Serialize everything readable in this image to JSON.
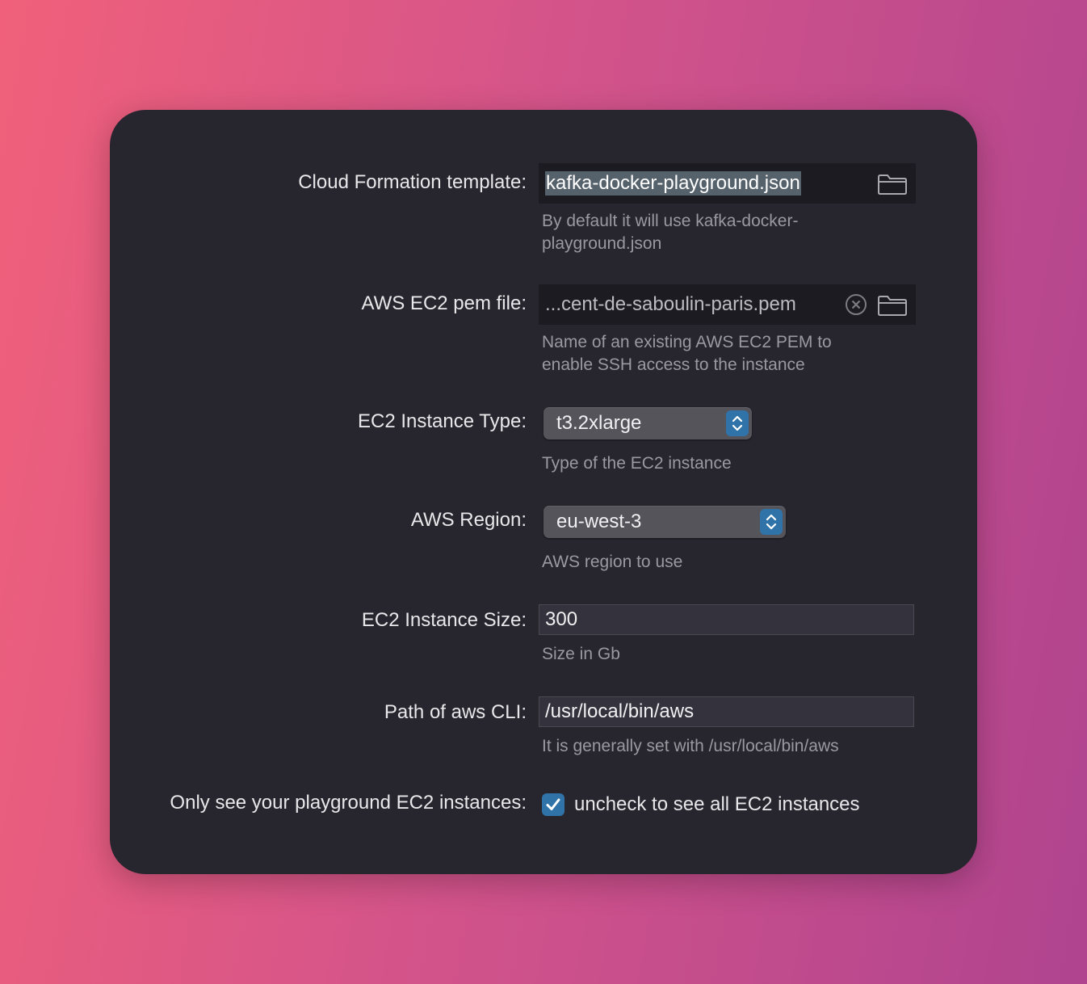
{
  "form": {
    "template": {
      "label": "Cloud Formation template:",
      "value": "kafka-docker-playground.json",
      "help": "By default it will use kafka-docker-playground.json",
      "folder_icon": "folder-icon"
    },
    "pem": {
      "label": "AWS EC2 pem file:",
      "value": "...cent-de-saboulin-paris.pem",
      "help": "Name of an existing AWS EC2 PEM to enable SSH access to the instance",
      "clear_icon": "clear-icon",
      "folder_icon": "folder-icon"
    },
    "instance_type": {
      "label": "EC2 Instance Type:",
      "value": "t3.2xlarge",
      "help": "Type of the EC2 instance"
    },
    "region": {
      "label": "AWS Region:",
      "value": "eu-west-3",
      "help": "AWS region to use"
    },
    "instance_size": {
      "label": "EC2 Instance Size:",
      "value": "300",
      "help": "Size in Gb"
    },
    "cli_path": {
      "label": "Path of aws CLI:",
      "value": "/usr/local/bin/aws",
      "help": "It is generally set with /usr/local/bin/aws"
    },
    "only_playground": {
      "label": "Only see your playground EC2 instances:",
      "checked": true,
      "checkbox_label": "uncheck to see all EC2 instances"
    }
  },
  "colors": {
    "panel": "#27262e",
    "accent": "#2f73a8",
    "selection": "#56626b"
  }
}
